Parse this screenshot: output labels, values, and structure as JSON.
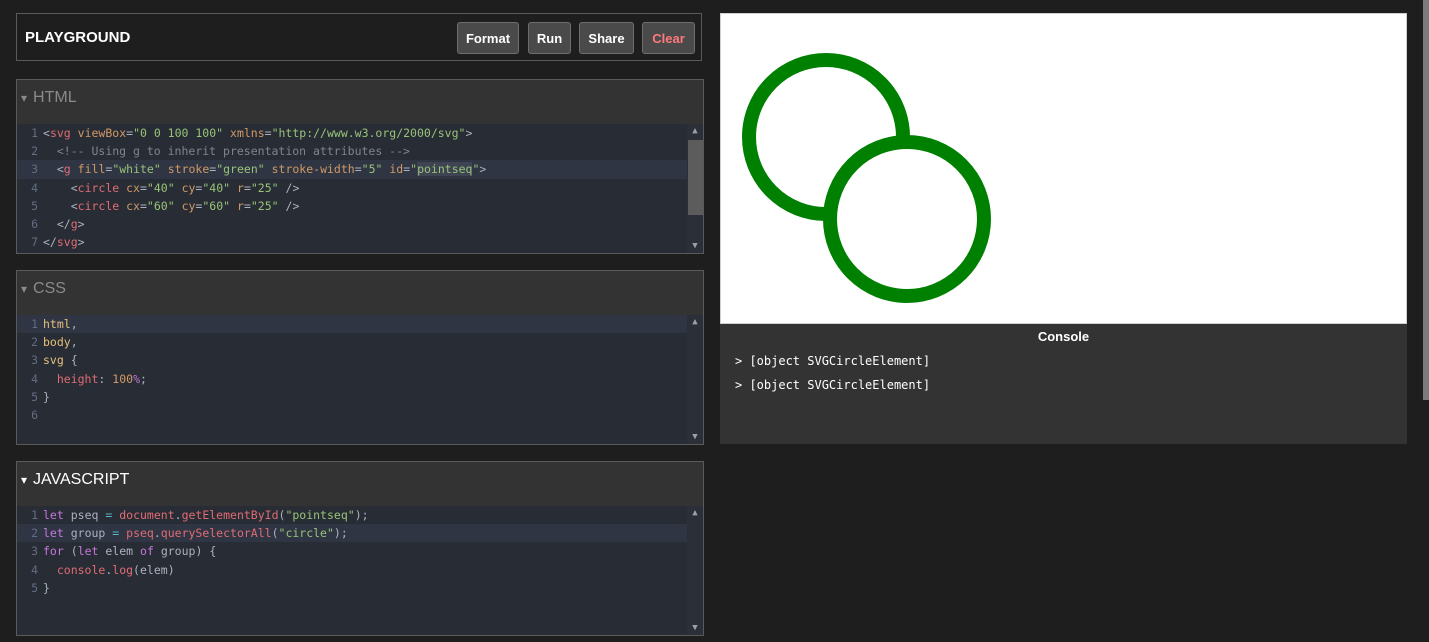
{
  "header": {
    "title": "PLAYGROUND",
    "buttons": {
      "format": "Format",
      "run": "Run",
      "share": "Share",
      "clear": "Clear"
    }
  },
  "panels": {
    "html": {
      "label": "HTML",
      "arrow": "▾"
    },
    "css": {
      "label": "CSS",
      "arrow": "▾"
    },
    "js": {
      "label": "JAVASCRIPT",
      "arrow": "▾"
    }
  },
  "line_numbers": {
    "html": [
      "1",
      "2",
      "3",
      "4",
      "5",
      "6",
      "7"
    ],
    "css": [
      "1",
      "2",
      "3",
      "4",
      "5",
      "6"
    ],
    "js": [
      "1",
      "2",
      "3",
      "4",
      "5"
    ]
  },
  "code": {
    "html": {
      "l1": {
        "lt": "<",
        "tag": "svg",
        "a1": "viewBox",
        "eq1": "=",
        "v1": "\"0 0 100 100\"",
        "a2": "xmlns",
        "eq2": "=",
        "v2": "\"http://www.w3.org/2000/svg\"",
        "gt": ">"
      },
      "l2": {
        "comment": "<!-- Using g to inherit presentation attributes -->"
      },
      "l3": {
        "lt": "<",
        "tag": "g",
        "a1": "fill",
        "eq": "=",
        "v1": "\"white\"",
        "a2": "stroke",
        "v2": "\"green\"",
        "a3": "stroke-width",
        "v3": "\"5\"",
        "a4": "id",
        "q": "\"",
        "v4": "pointseq",
        "gt": ">"
      },
      "l4": {
        "lt": "<",
        "tag": "circle",
        "a1": "cx",
        "eq": "=",
        "v1": "\"40\"",
        "a2": "cy",
        "v2": "\"40\"",
        "a3": "r",
        "v3": "\"25\"",
        "close": "/>"
      },
      "l5": {
        "lt": "<",
        "tag": "circle",
        "a1": "cx",
        "eq": "=",
        "v1": "\"60\"",
        "a2": "cy",
        "v2": "\"60\"",
        "a3": "r",
        "v3": "\"25\"",
        "close": "/>"
      },
      "l6": {
        "lt": "</",
        "tag": "g",
        "gt": ">"
      },
      "l7": {
        "lt": "</",
        "tag": "svg",
        "gt": ">"
      }
    },
    "css": {
      "l1": {
        "sel": "html",
        "pun": ","
      },
      "l2": {
        "sel": "body",
        "pun": ","
      },
      "l3": {
        "sel": "svg",
        "brace": "{"
      },
      "l4": {
        "prop": "height",
        "colon": ":",
        "num": "100",
        "unit": "%",
        "semi": ";"
      },
      "l5": {
        "brace": "}"
      }
    },
    "js": {
      "l1": {
        "kw": "let",
        "var": "pseq",
        "op": "=",
        "obj": "document",
        "dot": ".",
        "fn": "getElementById",
        "lp": "(",
        "str": "\"pointseq\"",
        "rp": ");"
      },
      "l2": {
        "kw": "let",
        "var": "group",
        "op": "=",
        "obj": "pseq",
        "dot": ".",
        "fn": "querySelectorAll",
        "lp": "(",
        "str": "\"circle\"",
        "rp": ");"
      },
      "l3": {
        "kw": "for",
        "lp": "(",
        "kw2": "let",
        "var": "elem",
        "kw3": "of",
        "var2": "group",
        "rp": ")",
        "brace": "{"
      },
      "l4": {
        "obj": "console",
        "dot": ".",
        "fn": "log",
        "lp": "(",
        "var": "elem",
        "rp": ")"
      },
      "l5": {
        "brace": "}"
      }
    }
  },
  "preview": {
    "circle_fill": "#ffffff",
    "circle_stroke": "#008000"
  },
  "console": {
    "title": "Console",
    "lines": [
      "> [object SVGCircleElement]",
      "> [object SVGCircleElement]"
    ]
  },
  "colors": {
    "background": "#1e1e1e",
    "panel": "#333333",
    "editor": "#282c34",
    "clear_button_text": "#ff7a7a"
  }
}
